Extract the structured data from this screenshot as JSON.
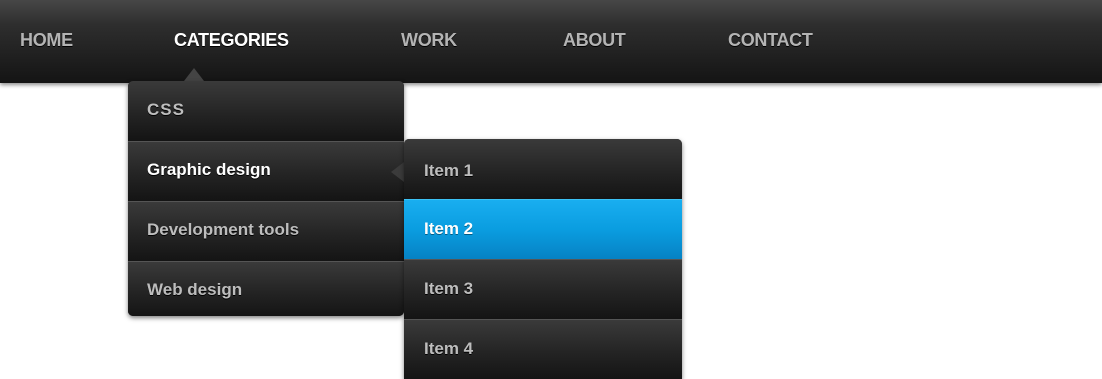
{
  "nav": {
    "items": [
      {
        "label": "HOME"
      },
      {
        "label": "CATEGORIES"
      },
      {
        "label": "WORK"
      },
      {
        "label": "ABOUT"
      },
      {
        "label": "CONTACT"
      }
    ],
    "active": "CATEGORIES"
  },
  "dropdown": {
    "items": [
      {
        "label": "CSS"
      },
      {
        "label": "Graphic design"
      },
      {
        "label": "Development tools"
      },
      {
        "label": "Web design"
      }
    ],
    "active": "Graphic design"
  },
  "submenu": {
    "items": [
      {
        "label": "Item 1"
      },
      {
        "label": "Item 2"
      },
      {
        "label": "Item 3"
      },
      {
        "label": "Item 4"
      }
    ],
    "highlighted": "Item 2"
  },
  "colors": {
    "bar_dark": "#141414",
    "highlight_blue": "#0a9de0",
    "text_inactive": "#b4b4b4",
    "text_active": "#ffffff"
  }
}
